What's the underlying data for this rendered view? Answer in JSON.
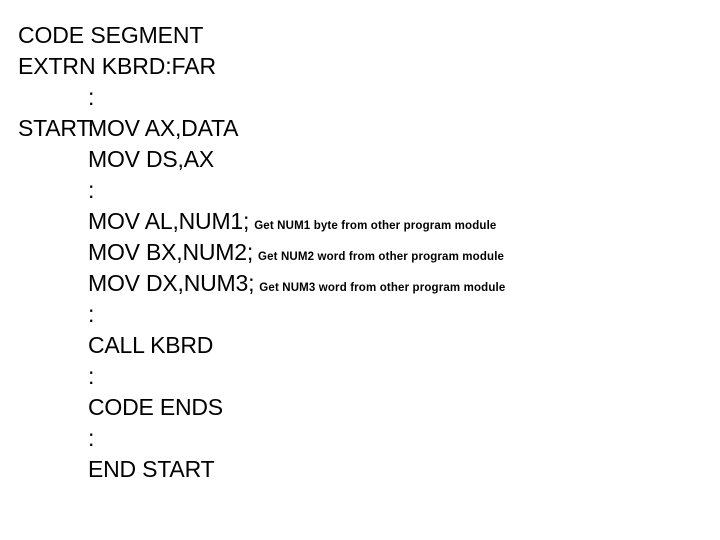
{
  "slide": {
    "background_color": "#ffffff",
    "text_color": "#000000",
    "title": "CODE SEGMENT",
    "code_listing": {
      "language": "8086 assembly",
      "lines": [
        {
          "label": "",
          "instruction": "CODE SEGMENT",
          "comment": ""
        },
        {
          "label": "",
          "instruction": "EXTRN KBRD:FAR",
          "comment": ""
        },
        {
          "label": "",
          "instruction": ":",
          "comment": ""
        },
        {
          "label": "START:",
          "instruction": "MOV AX,DATA",
          "comment": ""
        },
        {
          "label": "",
          "instruction": "MOV DS,AX",
          "comment": ""
        },
        {
          "label": "",
          "instruction": ":",
          "comment": ""
        },
        {
          "label": "",
          "instruction": "MOV AL,NUM1;",
          "comment": "Get NUM1 byte from other program module"
        },
        {
          "label": "",
          "instruction": "MOV BX,NUM2;",
          "comment": "Get NUM2 word from other program module"
        },
        {
          "label": "",
          "instruction": "MOV DX,NUM3;",
          "comment": "Get NUM3 word from other program module"
        },
        {
          "label": "",
          "instruction": ":",
          "comment": ""
        },
        {
          "label": "",
          "instruction": "CALL KBRD",
          "comment": ""
        },
        {
          "label": "",
          "instruction": ":",
          "comment": ""
        },
        {
          "label": "",
          "instruction": "CODE ENDS",
          "comment": ""
        },
        {
          "label": "",
          "instruction": ":",
          "comment": ""
        },
        {
          "label": "",
          "instruction": "END START",
          "comment": ""
        }
      ]
    }
  }
}
